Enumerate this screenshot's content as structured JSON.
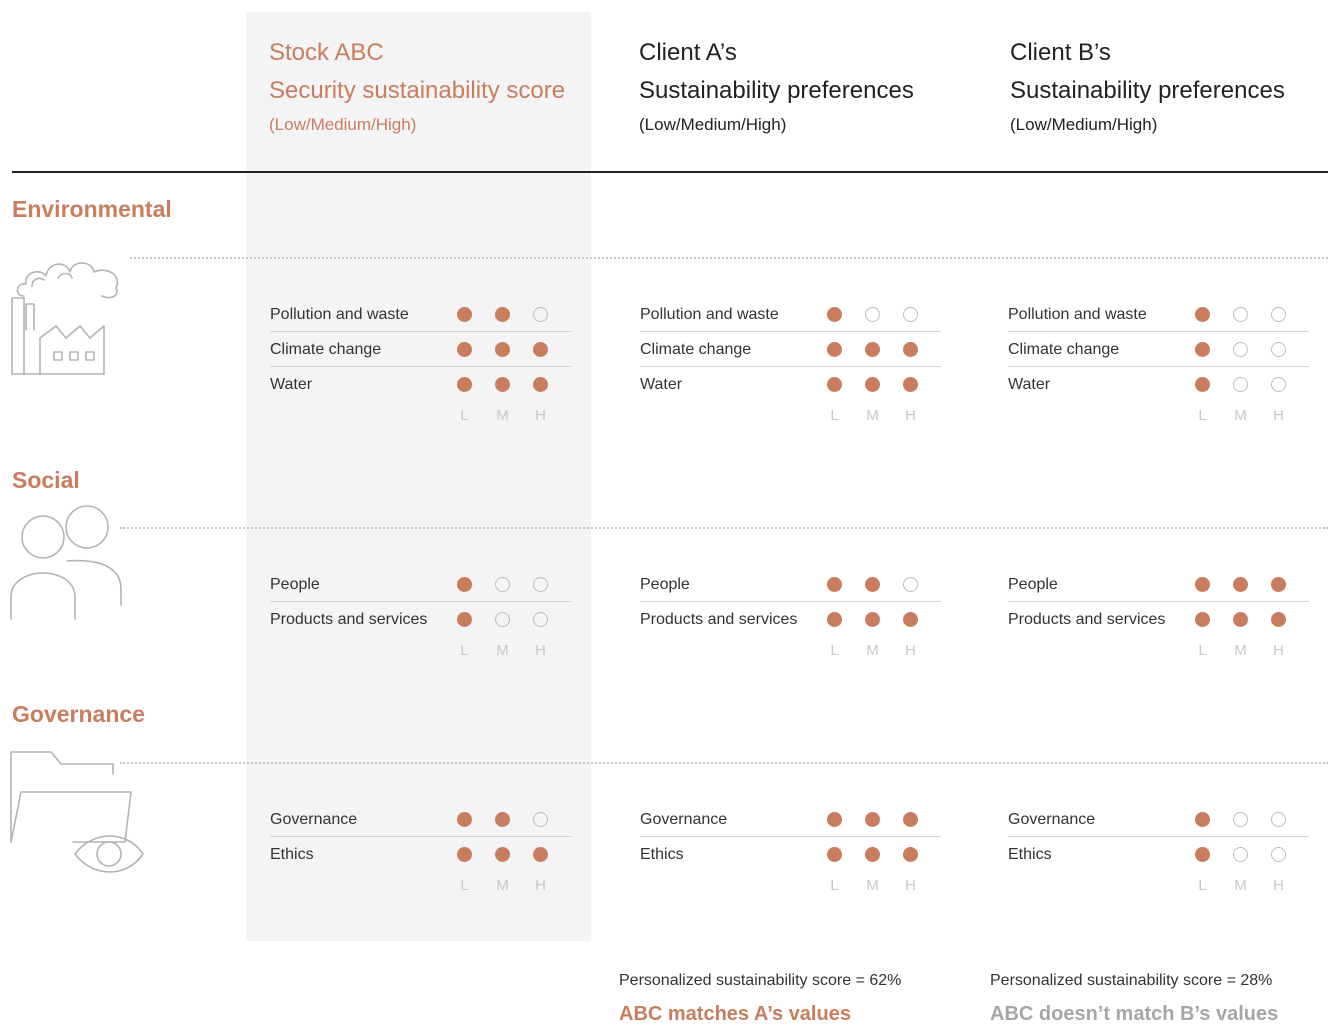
{
  "columns": {
    "stock": {
      "line1": "Stock ABC",
      "line2": "Security sustainability score",
      "line3": "(Low/Medium/High)"
    },
    "client_a": {
      "line1": "Client A’s",
      "line2": "Sustainability preferences",
      "line3": "(Low/Medium/High)"
    },
    "client_b": {
      "line1": "Client B’s",
      "line2": "Sustainability preferences",
      "line3": "(Low/Medium/High)"
    }
  },
  "scale": {
    "low": "L",
    "medium": "M",
    "high": "H"
  },
  "sections": [
    {
      "title": "Environmental",
      "icon": "factory-icon",
      "rows": [
        {
          "label": "Pollution and waste",
          "stock": 2,
          "client_a": 1,
          "client_b": 1
        },
        {
          "label": "Climate change",
          "stock": 3,
          "client_a": 3,
          "client_b": 1
        },
        {
          "label": "Water",
          "stock": 3,
          "client_a": 3,
          "client_b": 1
        }
      ]
    },
    {
      "title": "Social",
      "icon": "people-icon",
      "rows": [
        {
          "label": "People",
          "stock": 1,
          "client_a": 2,
          "client_b": 3
        },
        {
          "label": "Products and services",
          "stock": 1,
          "client_a": 3,
          "client_b": 3
        }
      ]
    },
    {
      "title": "Governance",
      "icon": "folder-eye-icon",
      "rows": [
        {
          "label": "Governance",
          "stock": 2,
          "client_a": 3,
          "client_b": 1
        },
        {
          "label": "Ethics",
          "stock": 3,
          "client_a": 3,
          "client_b": 1
        }
      ]
    }
  ],
  "results": {
    "client_a": {
      "score": "Personalized sustainability score = 62%",
      "verdict": "ABC matches A’s values"
    },
    "client_b": {
      "score": "Personalized sustainability score = 28%",
      "verdict": "ABC doesn’t match B’s values"
    }
  },
  "colors": {
    "accent": "#c97d5f",
    "empty_dot": "#bdbdbd",
    "panel": "#f4f4f4",
    "scale_label": "#c8c8c8",
    "muted_verdict": "#a6a6a6"
  }
}
